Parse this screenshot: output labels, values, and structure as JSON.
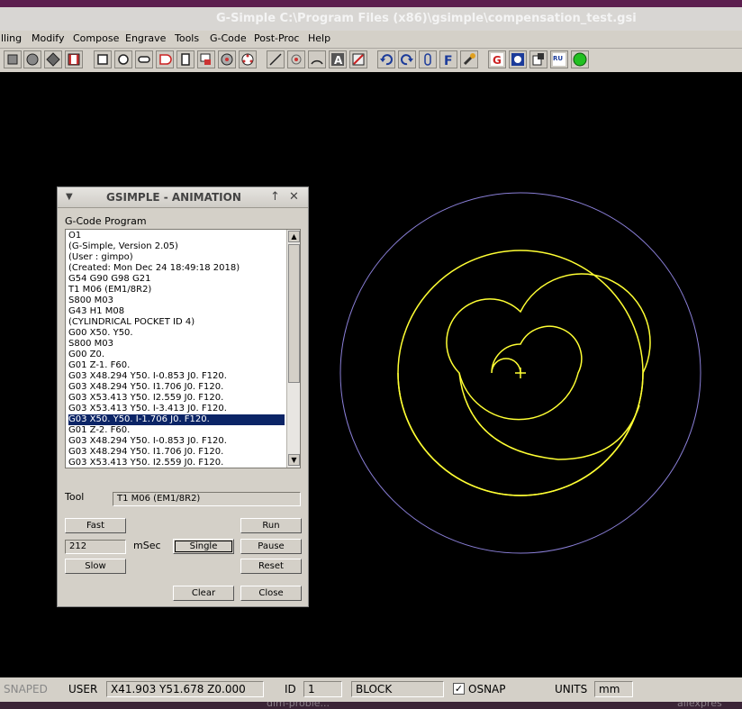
{
  "window": {
    "title": "G-Simple C:\\Program Files (x86)\\gsimple\\compensation_test.gsi"
  },
  "menu": [
    "lling",
    "Modify",
    "Compose",
    "Engrave",
    "Tools",
    "G-Code",
    "Post-Proc",
    "Help"
  ],
  "toolbar": {
    "icons": [
      "rectangle-tool-icon",
      "circle-tool-icon",
      "polygon-tool-icon",
      "delete-tool-icon",
      "square-pocket-icon",
      "circle-pocket-icon",
      "slot-icon",
      "arc-pocket-icon",
      "door-pocket-icon",
      "rect-pocket-icon",
      "gear-pocket-icon",
      "circle-pattern-icon",
      "line-tool-icon",
      "point-tool-icon",
      "arc-tool-icon",
      "text-tool-icon",
      "erase-tool-icon",
      "undo-icon",
      "redo-icon",
      "clip-icon",
      "font-icon",
      "wrench-icon",
      "gcode-icon",
      "animation-icon",
      "post-icon",
      "run-icon",
      "go-icon"
    ],
    "font_label": "F",
    "gcode_label": "G",
    "run_label": "RU"
  },
  "dialog": {
    "title": "GSIMPLE - ANIMATION",
    "program_label": "G-Code Program",
    "program_lines": [
      "O1",
      "(G-Simple, Version 2.05)",
      "(User : gimpo)",
      "(Created: Mon Dec 24 18:49:18 2018)",
      "G54 G90 G98 G21",
      "T1 M06 (EM1/8R2)",
      "S800 M03",
      "G43 H1 M08",
      "(CYLINDRICAL POCKET ID 4)",
      "G00 X50. Y50.",
      "S800 M03",
      "G00 Z0.",
      "G01 Z-1. F60.",
      "G03 X48.294 Y50. I-0.853 J0. F120.",
      "G03 X48.294 Y50. I1.706 J0. F120.",
      "G03 X53.413 Y50. I2.559 J0. F120.",
      "G03 X53.413 Y50. I-3.413 J0. F120.",
      "G03 X50. Y50. I-1.706 J0. F120.",
      "G01 Z-2. F60.",
      "G03 X48.294 Y50. I-0.853 J0. F120.",
      "G03 X48.294 Y50. I1.706 J0. F120.",
      "G03 X53.413 Y50. I2.559 J0. F120."
    ],
    "selected_line": 17,
    "tool_label": "Tool",
    "tool_value": "T1 M06 (EM1/8R2)",
    "fast_label": "Fast",
    "msec_value": "212",
    "msec_label": "mSec",
    "slow_label": "Slow",
    "single_label": "Single",
    "run_label": "Run",
    "pause_label": "Pause",
    "reset_label": "Reset",
    "clear_label": "Clear",
    "close_label": "Close"
  },
  "status": {
    "snap_label": "SNAPED",
    "user_label": "USER",
    "coords": "X41.903 Y51.678 Z0.000",
    "id_label": "ID",
    "id_value": "1",
    "block_value": "BLOCK",
    "osnap_label": "OSNAP",
    "osnap_checked": true,
    "units_label": "UNITS",
    "units_value": "mm"
  },
  "taskbar": {
    "left": "dim-proble...",
    "right": "aliexpres"
  },
  "colors": {
    "path": "#ffff33",
    "stock": "#8a7fd8",
    "selection": "#0b2466"
  }
}
